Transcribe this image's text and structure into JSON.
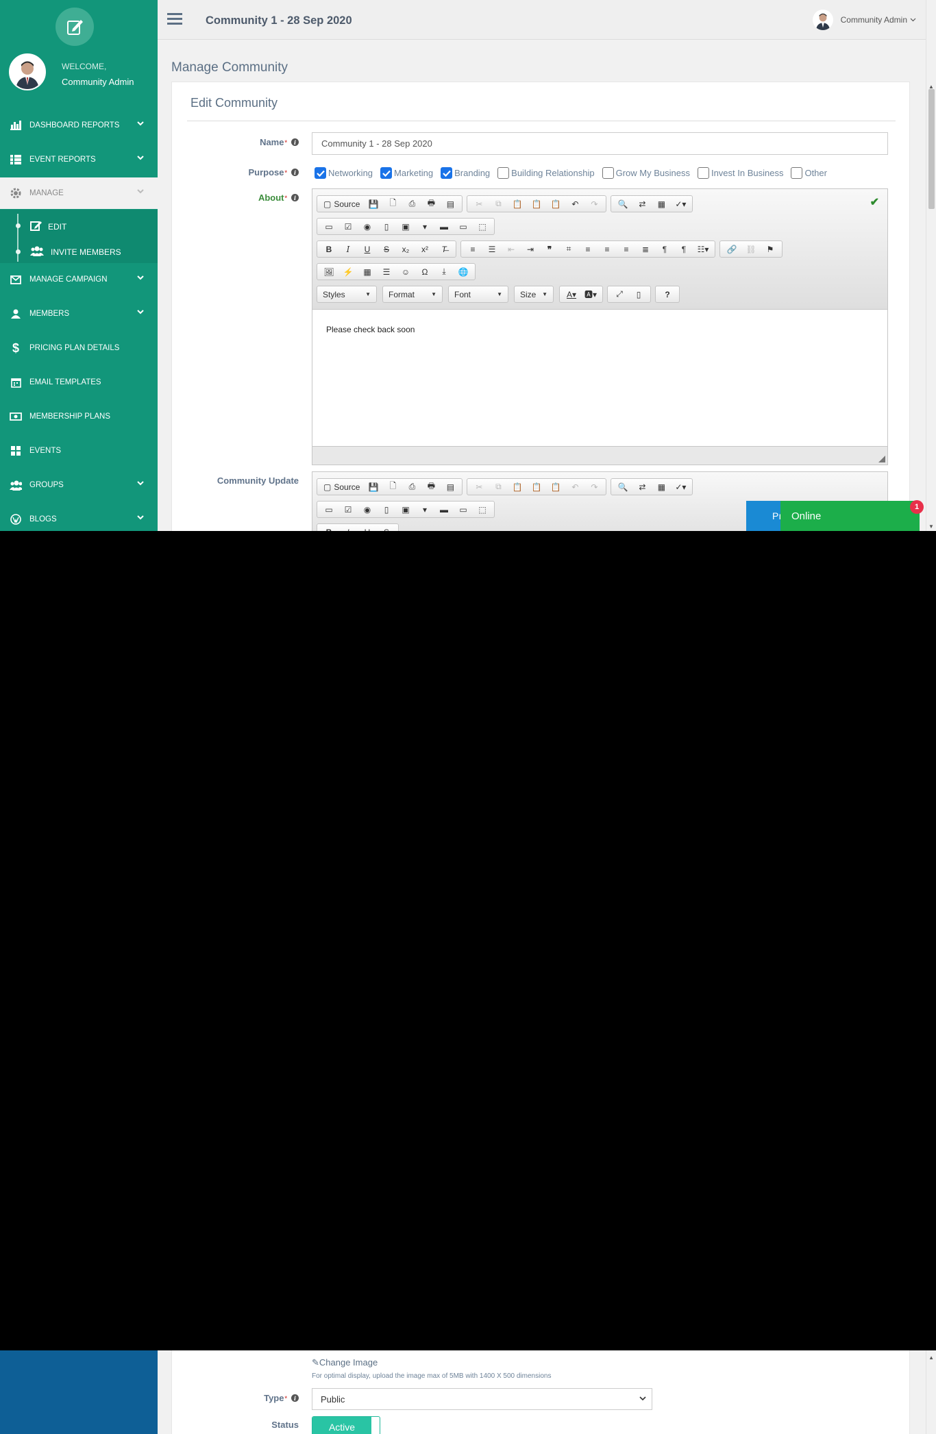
{
  "app": {
    "title": "Community 1 - 28 Sep 2020",
    "user_name": "Community Admin"
  },
  "sidebar": {
    "welcome": "WELCOME,",
    "welcome_name": "Community Admin",
    "items": [
      {
        "label": "DASHBOARD REPORTS",
        "icon": "bar-chart-icon",
        "has_chevron": true
      },
      {
        "label": "EVENT REPORTS",
        "icon": "grid-icon",
        "has_chevron": true
      },
      {
        "label": "MANAGE",
        "icon": "gear-icon",
        "has_chevron": true,
        "active": true
      },
      {
        "label": "MANAGE CAMPAIGN",
        "icon": "envelope-icon",
        "has_chevron": true
      },
      {
        "label": "MEMBERS",
        "icon": "user-icon",
        "has_chevron": true
      },
      {
        "label": "PRICING PLAN DETAILS",
        "icon": "dollar-icon",
        "has_chevron": false
      },
      {
        "label": "EMAIL TEMPLATES",
        "icon": "calendar-icon",
        "has_chevron": false
      },
      {
        "label": "MEMBERSHIP PLANS",
        "icon": "money-icon",
        "has_chevron": false
      },
      {
        "label": "EVENTS",
        "icon": "grid-icon",
        "has_chevron": false
      },
      {
        "label": "GROUPS",
        "icon": "users-icon",
        "has_chevron": true
      },
      {
        "label": "BLOGS",
        "icon": "wordpress-icon",
        "has_chevron": true
      }
    ],
    "sub_items": [
      {
        "label": "EDIT",
        "icon": "edit-icon"
      },
      {
        "label": "INVITE MEMBERS",
        "icon": "users-icon"
      }
    ]
  },
  "main": {
    "page_title": "Manage Community",
    "card_title": "Edit Community",
    "fields": {
      "name_label": "Name",
      "name_value": "Community 1 - 28 Sep 2020",
      "purpose_label": "Purpose",
      "about_label": "About",
      "community_update_label": "Community Update",
      "type_label": "Type",
      "type_value": "Public",
      "status_label": "Status",
      "status_value": "Active"
    },
    "purposes": [
      {
        "label": "Networking",
        "checked": true
      },
      {
        "label": "Marketing",
        "checked": true
      },
      {
        "label": "Branding",
        "checked": true
      },
      {
        "label": "Building Relationship",
        "checked": false
      },
      {
        "label": "Grow My Business",
        "checked": false
      },
      {
        "label": "Invest In Business",
        "checked": false
      },
      {
        "label": "Other",
        "checked": false
      }
    ],
    "editor": {
      "source_label": "Source",
      "styles_label": "Styles",
      "format_label": "Format",
      "font_label": "Font",
      "size_label": "Size",
      "about_content": "Please check back soon"
    },
    "image": {
      "change_label": "Change Image",
      "hint": "For optimal display, upload the image max of 5MB with 1400 X 500 dimensions"
    }
  },
  "chat": {
    "partial_label": "Pı",
    "online_label": "Online",
    "badge_count": "1"
  },
  "colors": {
    "sidebar": "#12967a",
    "sidebar_lower": "#0e5f96",
    "accent_checkbox": "#1a73e8",
    "status_active": "#29c4a4",
    "chat_online": "#1cae4a",
    "chat_badge": "#e8304a"
  }
}
